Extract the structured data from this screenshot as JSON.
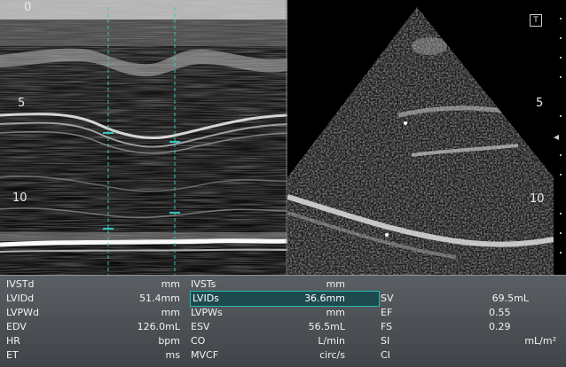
{
  "depth_scale": {
    "mmode": [
      "0",
      "5",
      "10"
    ],
    "sector": [
      "5",
      "10"
    ]
  },
  "sector_marker": "T",
  "measurements": {
    "col1": [
      {
        "label": "IVSTd",
        "value": "mm"
      },
      {
        "label": "LVIDd",
        "value": "51.4mm"
      },
      {
        "label": "LVPWd",
        "value": "mm"
      },
      {
        "label": "EDV",
        "value": "126.0mL"
      },
      {
        "label": "HR",
        "value": "bpm"
      },
      {
        "label": "ET",
        "value": "ms"
      }
    ],
    "col2": [
      {
        "label": "IVSTs",
        "value": "mm"
      },
      {
        "label": "LVIDs",
        "value": "36.6mm",
        "active": true
      },
      {
        "label": "LVPWs",
        "value": "mm"
      },
      {
        "label": "ESV",
        "value": "56.5mL"
      },
      {
        "label": "CO",
        "value": "L/min"
      },
      {
        "label": "MVCF",
        "value": "circ/s"
      }
    ],
    "col3": [
      {
        "label": "",
        "value": ""
      },
      {
        "label": "SV",
        "value": "69.5mL"
      },
      {
        "label": "EF",
        "value": "0.55"
      },
      {
        "label": "FS",
        "value": "0.29"
      },
      {
        "label": "SI",
        "value": "mL/m²"
      },
      {
        "label": "CI",
        "value": ""
      }
    ]
  },
  "colors": {
    "caliper": "#33c7bd",
    "panel_bg": "#50555a",
    "highlight": "#26b8b0"
  }
}
